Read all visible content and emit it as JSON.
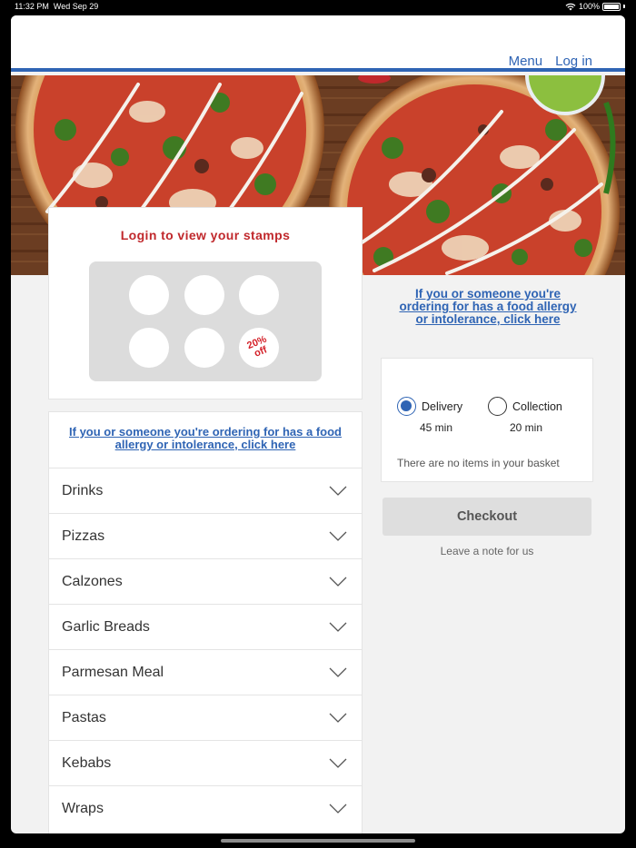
{
  "status_bar": {
    "time": "11:32 PM",
    "date": "Wed Sep 29",
    "battery": "100%"
  },
  "nav": {
    "menu_label": "Menu",
    "login_label": "Log in"
  },
  "stamps": {
    "title": "Login to view your stamps",
    "offer_line1": "20%",
    "offer_line2": "off"
  },
  "allergy_notice": "If you or someone you're ordering for has a food allergy or intolerance, click here",
  "categories": [
    "Drinks",
    "Pizzas",
    "Calzones",
    "Garlic Breads",
    "Parmesan Meal",
    "Pastas",
    "Kebabs",
    "Wraps"
  ],
  "order": {
    "delivery_label": "Delivery",
    "delivery_time": "45 min",
    "collection_label": "Collection",
    "collection_time": "20 min",
    "basket_empty": "There are no items in your basket",
    "checkout_label": "Checkout",
    "note_label": "Leave a note for us"
  },
  "colors": {
    "brand_blue": "#2f64b4",
    "stamp_red": "#c0282c"
  }
}
